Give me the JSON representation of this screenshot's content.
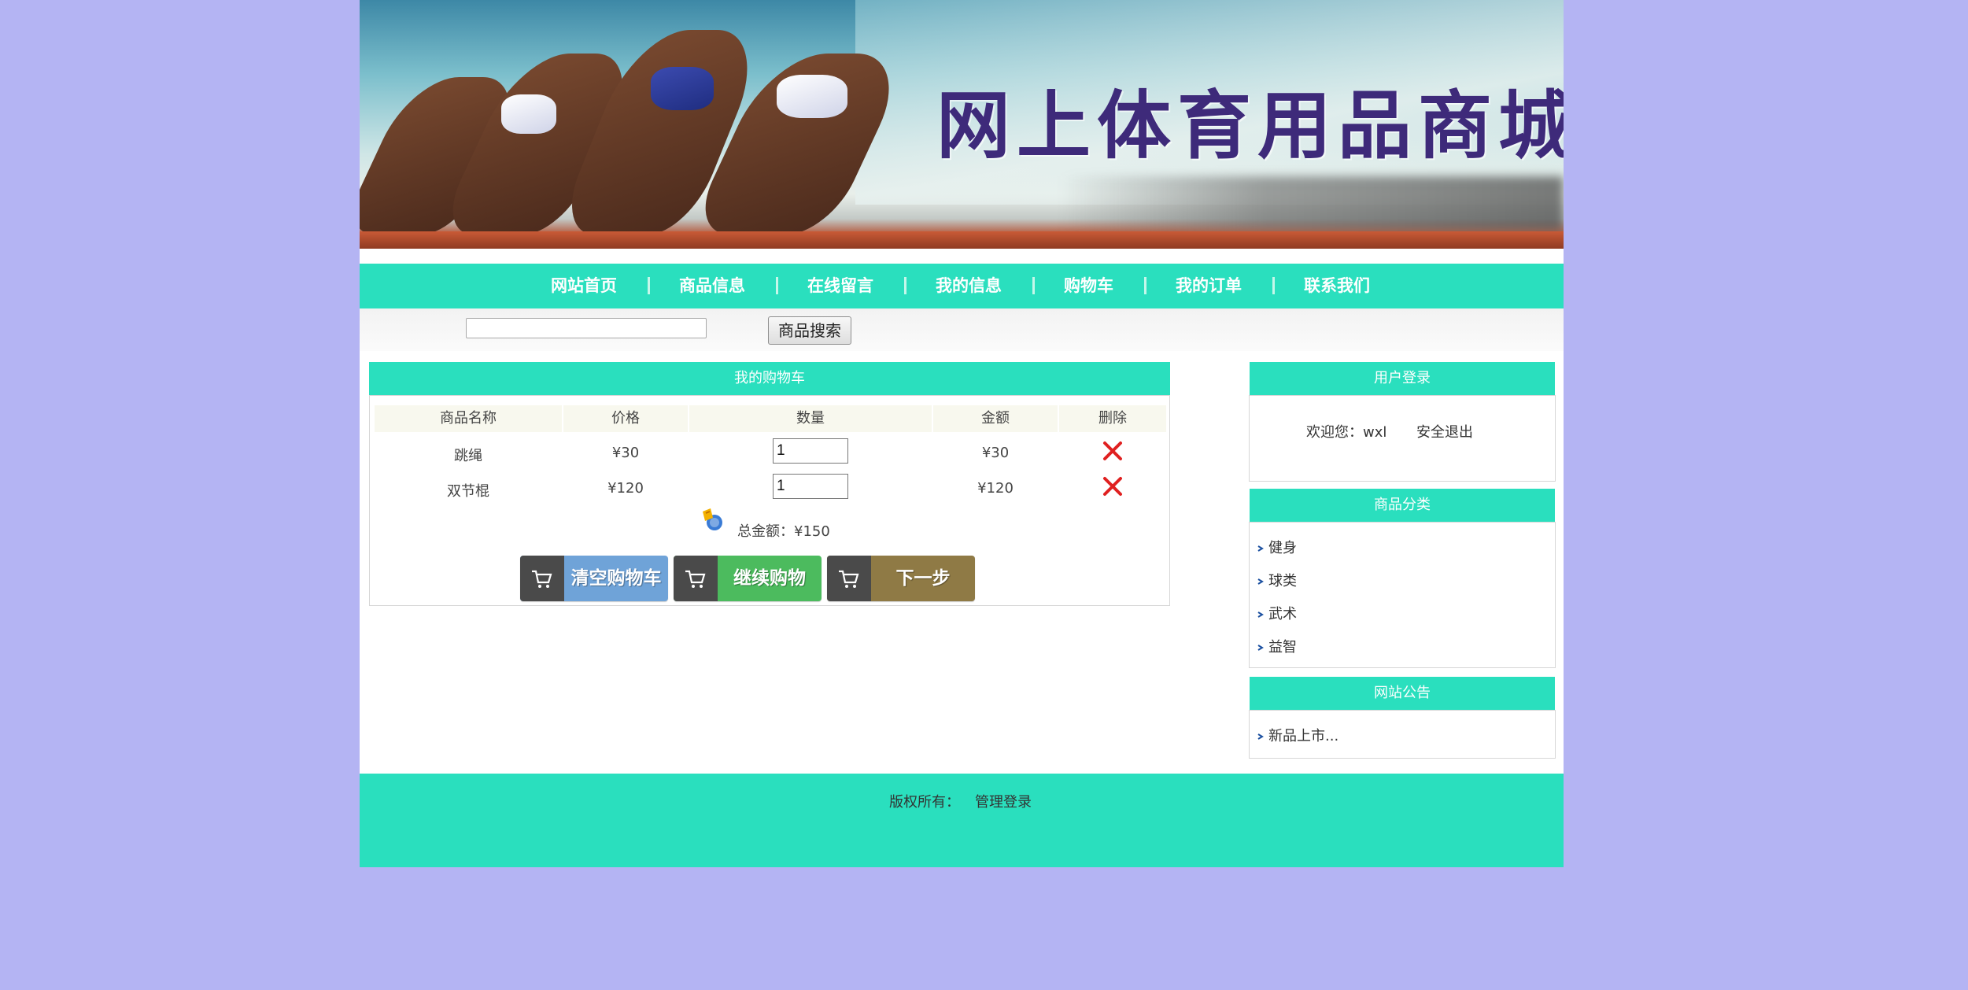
{
  "banner": {
    "title": "网上体育用品商城"
  },
  "nav": {
    "items": [
      "网站首页",
      "商品信息",
      "在线留言",
      "我的信息",
      "购物车",
      "我的订单",
      "联系我们"
    ]
  },
  "search": {
    "value": "",
    "button_label": "商品搜索"
  },
  "cart": {
    "title": "我的购物车",
    "columns": [
      "商品名称",
      "价格",
      "数量",
      "金额",
      "删除"
    ],
    "rows": [
      {
        "name": "跳绳",
        "price": "¥30",
        "qty": "1",
        "amount": "¥30"
      },
      {
        "name": "双节棍",
        "price": "¥120",
        "qty": "1",
        "amount": "¥120"
      }
    ],
    "total_label": "总金额：¥150",
    "buttons": {
      "clear": "清空购物车",
      "continue": "继续购物",
      "next": "下一步"
    },
    "button_colors": {
      "clear": "#6fa3d8",
      "continue": "#4cbb5e",
      "next": "#8f7a45"
    }
  },
  "login": {
    "title": "用户登录",
    "welcome": "欢迎您：wxl",
    "logout": "安全退出"
  },
  "categories": {
    "title": "商品分类",
    "items": [
      "健身",
      "球类",
      "武术",
      "益智"
    ]
  },
  "notice": {
    "title": "网站公告",
    "items": [
      "新品上市..."
    ]
  },
  "footer": {
    "copyright": "版权所有：",
    "admin_link": "管理登录"
  },
  "colors": {
    "background": "#b4b4f3",
    "accent": "#2adfbe",
    "delete": "#e02020"
  }
}
